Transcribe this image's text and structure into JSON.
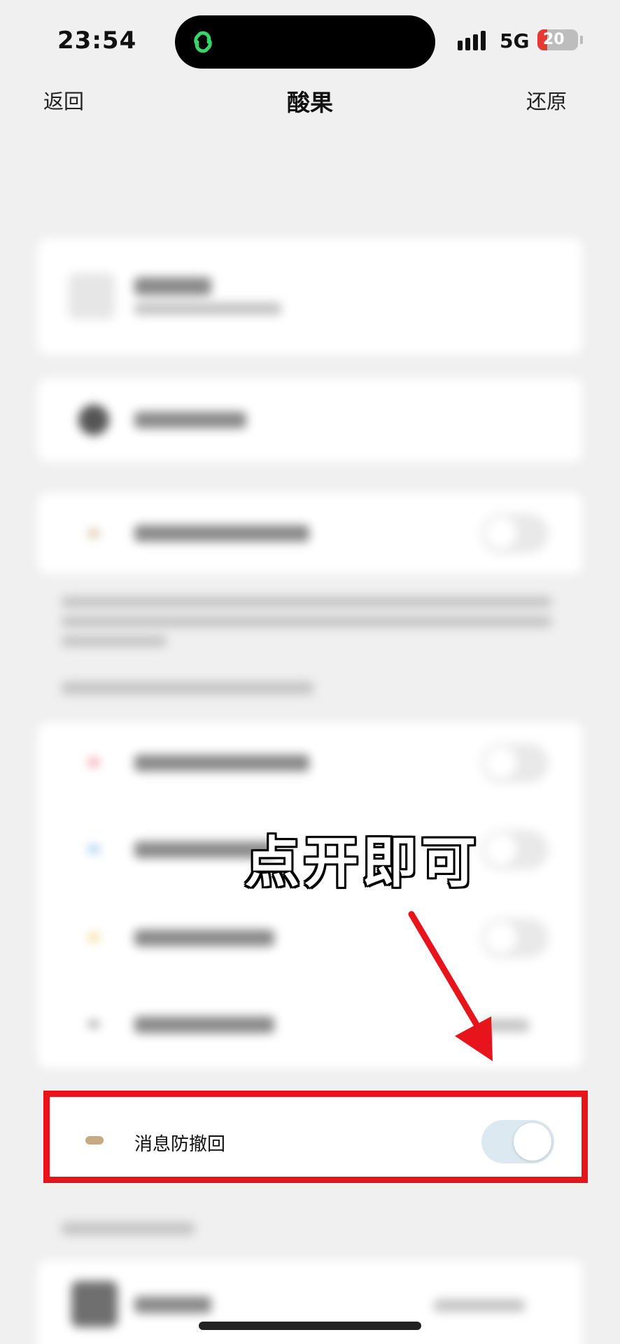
{
  "status_bar": {
    "time": "23:54",
    "network": "5G",
    "battery": "20"
  },
  "nav": {
    "back_label": "返回",
    "title": "酸果",
    "restore_label": "还原"
  },
  "highlight_row": {
    "label": "消息防撤回",
    "toggle_on": true
  },
  "overlay": {
    "caption": "点开即可"
  },
  "colors": {
    "highlight_border": "#e8141c",
    "arrow": "#e8141c",
    "toggle_on_track": "#dde9f1",
    "island_icon": "#3ad36a"
  }
}
